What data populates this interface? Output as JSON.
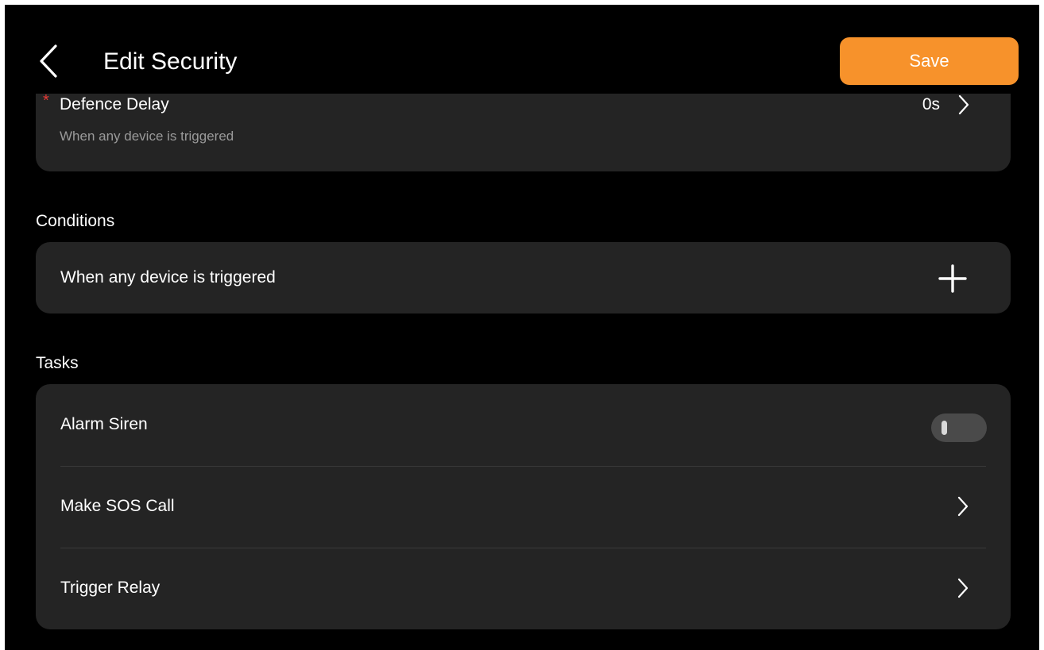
{
  "header": {
    "title": "Edit Security",
    "save_label": "Save"
  },
  "defence_delay": {
    "label": "Defence Delay",
    "required_mark": "*",
    "subtitle": "When any device is triggered",
    "value": "0s"
  },
  "conditions": {
    "section_title": "Conditions",
    "items": [
      {
        "label": "When any device is triggered"
      }
    ]
  },
  "tasks": {
    "section_title": "Tasks",
    "items": [
      {
        "label": "Alarm Siren",
        "control": "toggle",
        "enabled": false
      },
      {
        "label": "Make SOS Call",
        "control": "chevron"
      },
      {
        "label": "Trigger Relay",
        "control": "chevron"
      }
    ]
  },
  "colors": {
    "accent": "#f7922b",
    "background": "#000000",
    "card": "#242424",
    "required": "#e53935"
  }
}
